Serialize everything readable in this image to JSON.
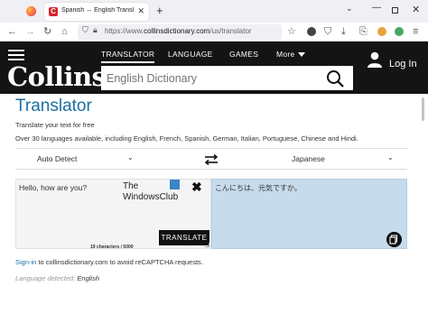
{
  "browser": {
    "tab_title": "Spanish ↔ English Translator | C",
    "tab_favicon": "C",
    "url_prefix": "https://www.",
    "url_domain": "collinsdictionary.com",
    "url_path": "/us/translator"
  },
  "header": {
    "logo": "Collins",
    "nav": [
      {
        "label": "TRANSLATOR",
        "active": true
      },
      {
        "label": "LANGUAGE",
        "active": false
      },
      {
        "label": "GAMES",
        "active": false
      },
      {
        "label": "More",
        "active": false
      }
    ],
    "login_label": "Log In",
    "search_placeholder": "English Dictionary"
  },
  "page": {
    "title": "Translator",
    "subtitle": "Translate your text for free",
    "languages_note": "Over 30 languages available, including English, French, Spanish, German, Italian, Portuguese, Chinese and Hindi."
  },
  "translator": {
    "source_language": "Auto Detect",
    "target_language": "Japanese",
    "source_text": "Hello, how are you?",
    "char_count": "19 characters / 5000",
    "translate_label": "TRANSLATE",
    "clear_label": "✖",
    "translated_text": "こんにちは、元気ですか。",
    "watermark_line1": "The",
    "watermark_line2": "WindowsClub"
  },
  "footer": {
    "signin_link": "Sign-in",
    "signin_rest": " to collinsdictionary.com to avoid reCAPTCHA requests.",
    "detected_label": "Language detected: ",
    "detected_value": "English"
  }
}
